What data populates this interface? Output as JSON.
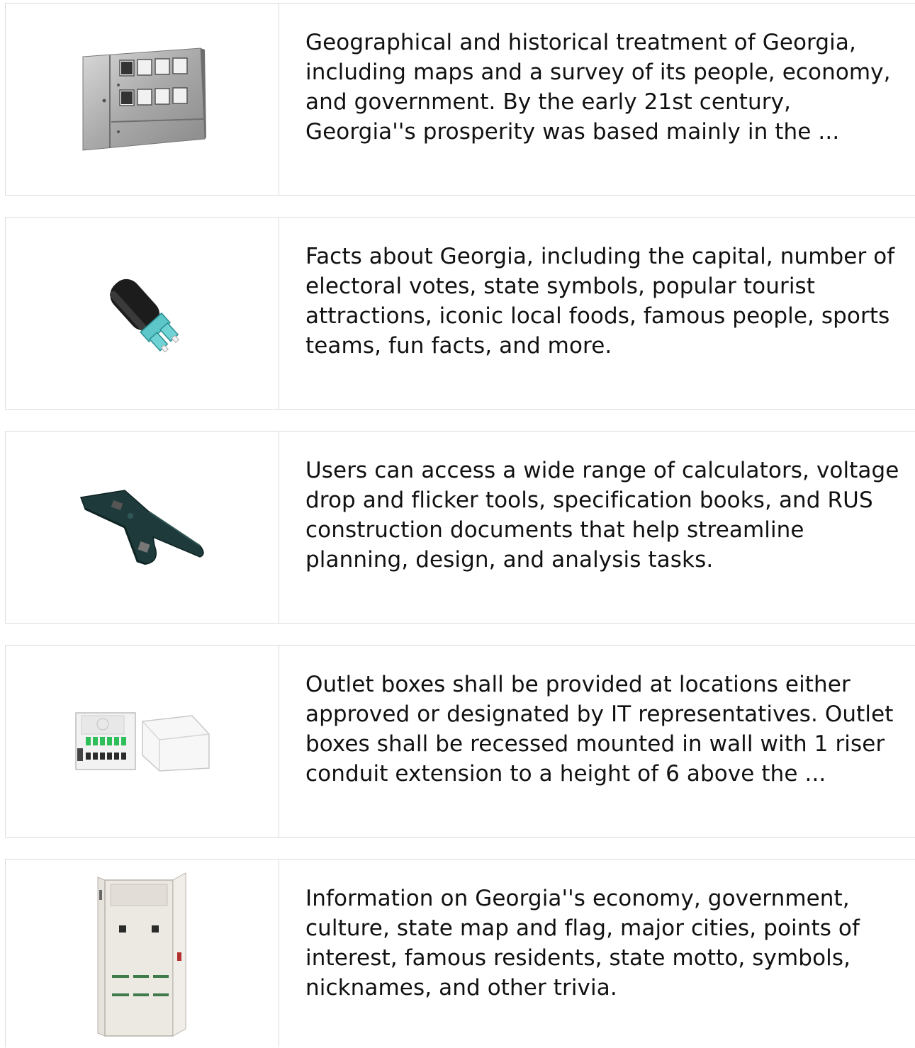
{
  "items": [
    {
      "image_icon": "stainless-meter-cabinet-icon",
      "description": "Geographical and historical treatment of Georgia, including maps and a survey of its people, economy, and government. By the early 21st century, Georgia''s prosperity was based mainly in the ..."
    },
    {
      "image_icon": "lc-fiber-connector-icon",
      "description": "Facts about Georgia, including the capital, number of electoral votes, state symbols, popular tourist attractions, iconic local foods, famous people, sports teams, fun facts, and more."
    },
    {
      "image_icon": "crimping-tool-icon",
      "description": "Users can access a wide range of calculators, voltage drop and flicker tools, specification books, and RUS construction documents that help streamline planning, design, and analysis tasks."
    },
    {
      "image_icon": "fiber-termination-box-icon",
      "description": "Outlet boxes shall be provided at locations either approved or designated by IT representatives. Outlet boxes shall be recessed mounted in wall with 1 riser conduit extension to a height of 6 above the ..."
    },
    {
      "image_icon": "floor-standing-cabinet-icon",
      "description": "Information on Georgia''s economy, government, culture, state map and flag, major cities, points of interest, famous residents, state motto, symbols, nicknames, and other trivia."
    }
  ]
}
